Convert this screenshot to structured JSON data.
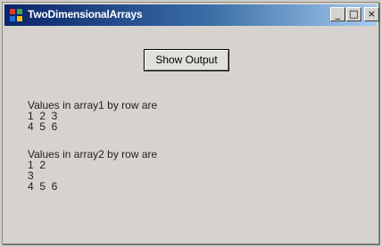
{
  "window": {
    "title": "TwoDimensionalArrays",
    "controls": {
      "minimize": "_",
      "maximize": "□",
      "close": "×"
    }
  },
  "button": {
    "label": "Show Output"
  },
  "output": {
    "array1": {
      "heading": "Values in array1 by row are",
      "rows": [
        "1  2  3",
        "4  5  6"
      ]
    },
    "array2": {
      "heading": "Values in array2 by row are",
      "rows": [
        "1  2",
        "3",
        "4  5  6"
      ]
    }
  },
  "icons": {
    "app": "windows-app-icon"
  },
  "colors": {
    "titlebar_start": "#0a246a",
    "titlebar_end": "#a6caf0"
  }
}
